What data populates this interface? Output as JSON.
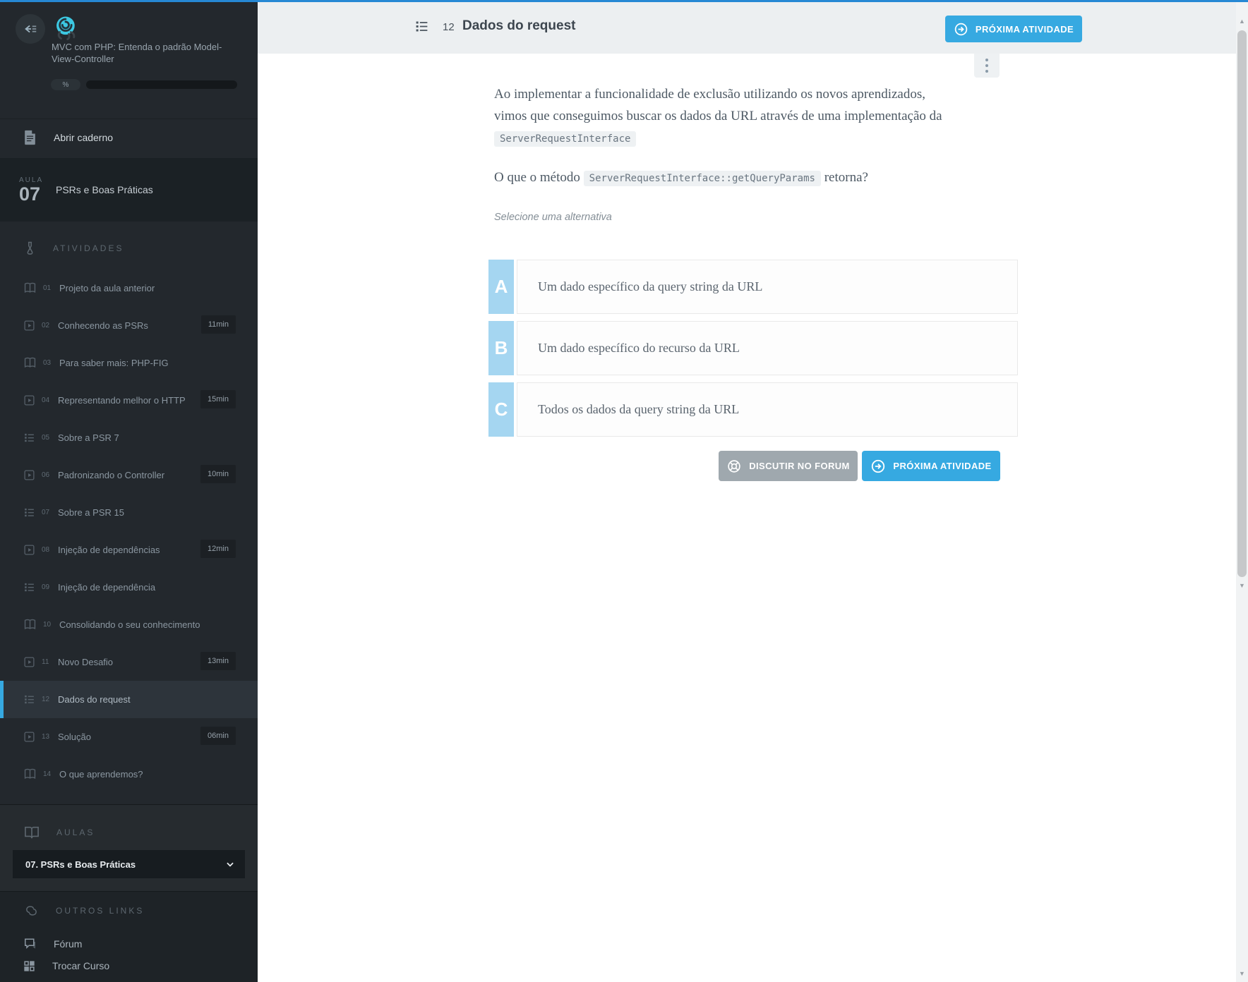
{
  "course": {
    "title": "MVC com PHP: Entenda o padrão Model-View-Controller",
    "progress_label": "%"
  },
  "sidebar": {
    "open_notebook_label": "Abrir caderno",
    "lesson": {
      "label": "AULA",
      "number": "07",
      "title": "PSRs e Boas Práticas"
    },
    "activities_header": "ATIVIDADES",
    "items": [
      {
        "num": "01",
        "label": "Projeto da aula anterior",
        "type": "book",
        "time": ""
      },
      {
        "num": "02",
        "label": "Conhecendo as PSRs",
        "type": "video",
        "time": "11min"
      },
      {
        "num": "03",
        "label": "Para saber mais: PHP-FIG",
        "type": "book",
        "time": ""
      },
      {
        "num": "04",
        "label": "Representando melhor o HTTP",
        "type": "video",
        "time": "15min"
      },
      {
        "num": "05",
        "label": "Sobre a PSR 7",
        "type": "list",
        "time": ""
      },
      {
        "num": "06",
        "label": "Padronizando o Controller",
        "type": "video",
        "time": "10min"
      },
      {
        "num": "07",
        "label": "Sobre a PSR 15",
        "type": "list",
        "time": ""
      },
      {
        "num": "08",
        "label": "Injeção de dependências",
        "type": "video",
        "time": "12min"
      },
      {
        "num": "09",
        "label": "Injeção de dependência",
        "type": "list",
        "time": ""
      },
      {
        "num": "10",
        "label": "Consolidando o seu conhecimento",
        "type": "book",
        "time": ""
      },
      {
        "num": "11",
        "label": "Novo Desafio",
        "type": "video",
        "time": "13min"
      },
      {
        "num": "12",
        "label": "Dados do request",
        "type": "list",
        "time": "",
        "active": true
      },
      {
        "num": "13",
        "label": "Solução",
        "type": "video",
        "time": "06min"
      },
      {
        "num": "14",
        "label": "O que aprendemos?",
        "type": "book",
        "time": ""
      }
    ],
    "aulas_header": "AULAS",
    "aulas_selected": "07. PSRs e Boas Práticas",
    "other_links_header": "OUTROS LINKS",
    "forum_label": "Fórum",
    "switch_course_label": "Trocar Curso"
  },
  "header": {
    "number": "12",
    "title": "Dados do request",
    "next_button_label": "PRÓXIMA ATIVIDADE"
  },
  "question": {
    "p1_text": "Ao implementar a funcionalidade de exclusão utilizando os novos aprendizados, vimos que conseguimos buscar os dados da URL através de uma implementação da ",
    "p1_code": "ServerRequestInterface",
    "p2_before": "O que o método ",
    "p2_code": "ServerRequestInterface::getQueryParams",
    "p2_after": " retorna?",
    "hint": "Selecione uma alternativa",
    "options": [
      {
        "letter": "A",
        "text": "Um dado específico da query string da URL"
      },
      {
        "letter": "B",
        "text": "Um dado específico do recurso da URL"
      },
      {
        "letter": "C",
        "text": "Todos os dados da query string da URL"
      }
    ]
  },
  "footer": {
    "discuss_label": "DISCUTIR NO FORUM",
    "next_label": "PRÓXIMA ATIVIDADE"
  },
  "colors": {
    "accent_blue": "#36a9e1",
    "top_line": "#2688d4",
    "sidebar_bg": "#23282d",
    "sidebar_active_bg": "#2d343b",
    "header_bg": "#eceff1",
    "option_letter_bg": "#a5d6f1",
    "gray_button": "#9fa8ae",
    "logo_cyan": "#3cc8e2"
  }
}
